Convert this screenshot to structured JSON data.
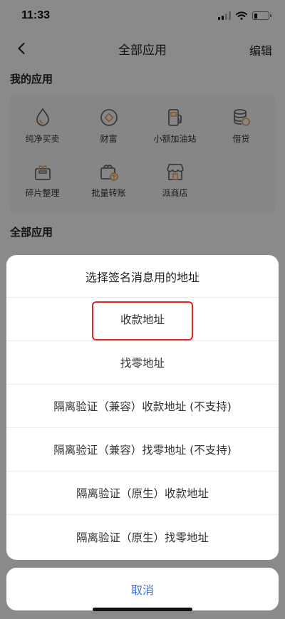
{
  "status": {
    "time": "11:33"
  },
  "nav": {
    "back": "‹",
    "title": "全部应用",
    "edit": "编辑"
  },
  "sections": {
    "my_apps": "我的应用",
    "all_apps": "全部应用"
  },
  "apps": [
    {
      "label": "纯净买卖",
      "icon": "droplet-icon"
    },
    {
      "label": "财富",
      "icon": "wealth-icon"
    },
    {
      "label": "小额加油站",
      "icon": "fuel-pump-icon"
    },
    {
      "label": "借贷",
      "icon": "coin-stack-icon"
    },
    {
      "label": "碎片整理",
      "icon": "gift-box-icon"
    },
    {
      "label": "批量转账",
      "icon": "basket-upload-icon"
    },
    {
      "label": "派商店",
      "icon": "store-icon"
    }
  ],
  "sheet": {
    "title": "选择签名消息用的地址",
    "options": [
      "收款地址",
      "找零地址",
      "隔离验证（兼容）收款地址 (不支持)",
      "隔离验证（兼容）找零地址 (不支持)",
      "隔离验证（原生）收款地址",
      "隔离验证（原生）找零地址"
    ],
    "cancel": "取消",
    "highlighted_index": 0
  },
  "colors": {
    "highlight": "#e8241f",
    "cancel_text": "#3f6bd8",
    "app_icon_stroke": "#6e6e6e",
    "app_icon_accent": "#f0a35c"
  }
}
